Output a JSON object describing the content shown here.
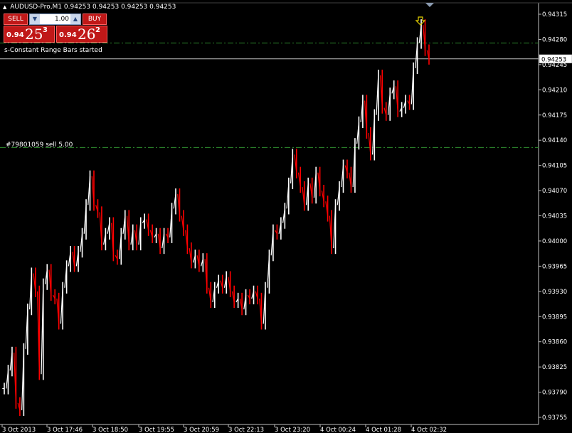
{
  "window": {
    "symbol_line": "AUDUSD-Pro,M1  0.94253 0.94253 0.94253 0.94253"
  },
  "trade_panel": {
    "sell_label": "SELL",
    "buy_label": "BUY",
    "lot_value": "1.00",
    "sell_price": {
      "prefix": "0.94",
      "big": "25",
      "sup": "3"
    },
    "buy_price": {
      "prefix": "0.94",
      "big": "26",
      "sup": "2"
    }
  },
  "status_message": "s-Constant Range Bars started",
  "order_line": {
    "label": "#79801059 sell 5.00",
    "price": 0.9413
  },
  "take_profit_line": {
    "price": 0.94275
  },
  "current_price": {
    "label": "0.94253",
    "value": 0.94253
  },
  "colors": {
    "background": "#000000",
    "bull": "#ffffff",
    "bear": "#ff0000",
    "order_line": "#2e8b2e",
    "grid_axis": "#c0c0c0",
    "current_price_line": "#c0c0c0",
    "arrow": "#e6d200"
  },
  "chart_data": {
    "type": "line",
    "series": [
      {
        "values": [
          0.93795,
          0.9382,
          0.93845,
          0.93775,
          0.93765,
          0.9385,
          0.93905,
          0.93955,
          0.9393,
          0.93815,
          0.9394,
          0.9396,
          0.93925,
          0.9392,
          0.93885,
          0.93935,
          0.93965,
          0.93985,
          0.93965,
          0.93985,
          0.9401,
          0.9405,
          0.9409,
          0.9405,
          0.9404,
          0.93995,
          0.9401,
          0.94025,
          0.9398,
          0.93975,
          0.9401,
          0.94035,
          0.93995,
          0.94015,
          0.93995,
          0.94025,
          0.9403,
          0.94015,
          0.94005,
          0.9401,
          0.9399,
          0.9401,
          0.94005,
          0.94045,
          0.94065,
          0.94035,
          0.94015,
          0.9399,
          0.9397,
          0.9398,
          0.93965,
          0.93975,
          0.93935,
          0.93915,
          0.93935,
          0.93945,
          0.93935,
          0.9395,
          0.9393,
          0.93915,
          0.9392,
          0.93905,
          0.93925,
          0.9392,
          0.9393,
          0.9392,
          0.93885,
          0.93935,
          0.9398,
          0.94015,
          0.9401,
          0.94025,
          0.94045,
          0.9408,
          0.9412,
          0.94095,
          0.94075,
          0.9405,
          0.9408,
          0.9406,
          0.94095,
          0.9407,
          0.94055,
          0.94035,
          0.9399,
          0.9405,
          0.94075,
          0.94105,
          0.94095,
          0.94075,
          0.94135,
          0.94165,
          0.94195,
          0.9415,
          0.9412,
          0.94175,
          0.9423,
          0.94185,
          0.94175,
          0.94205,
          0.94215,
          0.9418,
          0.94185,
          0.94195,
          0.9419,
          0.9424,
          0.94275,
          0.943,
          0.94265,
          0.94253
        ]
      }
    ],
    "x_labels": [
      "3 Oct 2013",
      "3 Oct 17:46",
      "3 Oct 18:50",
      "3 Oct 19:55",
      "3 Oct 20:59",
      "3 Oct 22:13",
      "3 Oct 23:20",
      "4 Oct 00:24",
      "4 Oct 01:28",
      "4 Oct 02:32"
    ],
    "y_ticks": [
      "0.94315",
      "0.94280",
      "0.94245",
      "0.94210",
      "0.94175",
      "0.94140",
      "0.94105",
      "0.94070",
      "0.94035",
      "0.94000",
      "0.93965",
      "0.93930",
      "0.93895",
      "0.93860",
      "0.93825",
      "0.93790",
      "0.93755"
    ],
    "ylim": [
      0.93755,
      0.94315
    ],
    "grid": false
  }
}
